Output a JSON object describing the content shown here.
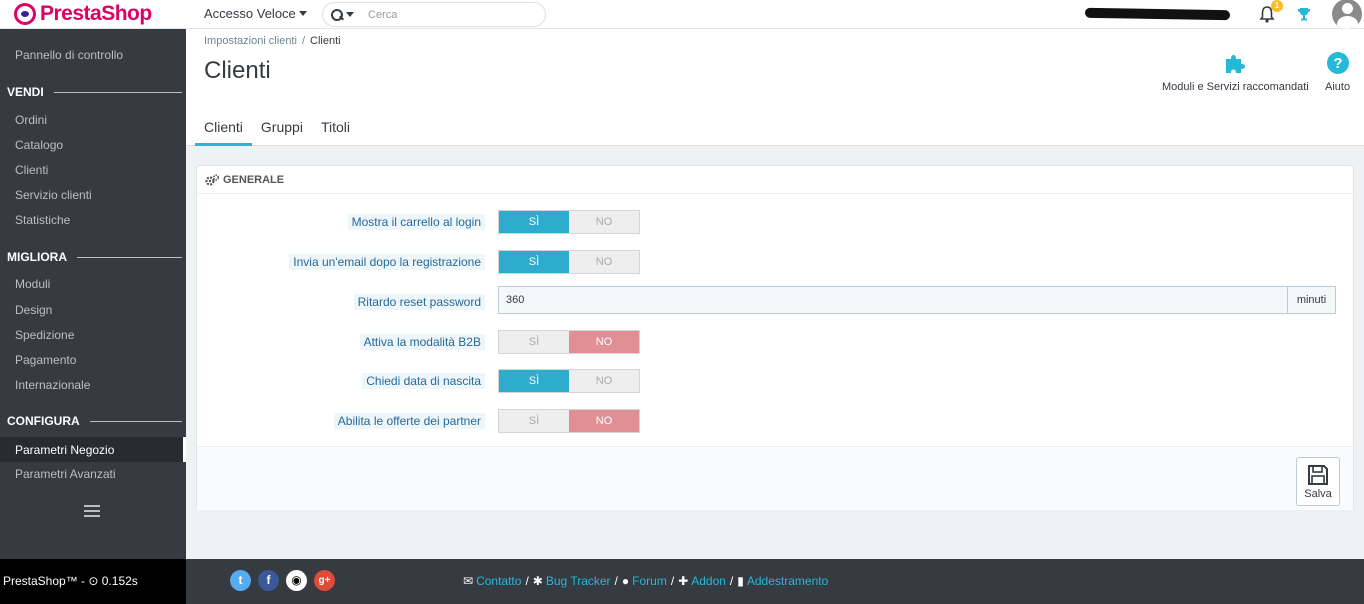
{
  "header": {
    "brand": "PrestaShop",
    "quick_access": "Accesso Veloce",
    "search_placeholder": "Cerca",
    "notifications_count": "1"
  },
  "sidebar": {
    "dashboard": "Pannello di controllo",
    "sections": [
      {
        "title": "VENDI",
        "items": [
          "Ordini",
          "Catalogo",
          "Clienti",
          "Servizio clienti",
          "Statistiche"
        ]
      },
      {
        "title": "MIGLIORA",
        "items": [
          "Moduli",
          "Design",
          "Spedizione",
          "Pagamento",
          "Internazionale"
        ]
      },
      {
        "title": "CONFIGURA",
        "items": [
          "Parametri Negozio",
          "Parametri Avanzati"
        ]
      }
    ],
    "active_item": "Parametri Negozio"
  },
  "page": {
    "breadcrumb": [
      "Impostazioni clienti",
      "Clienti"
    ],
    "title": "Clienti",
    "toolbar": {
      "modules_label": "Moduli e Servizi raccomandati",
      "help_label": "Aiuto"
    },
    "tabs": [
      "Clienti",
      "Gruppi",
      "Titoli"
    ],
    "active_tab": "Clienti"
  },
  "panel": {
    "title": "GENERALE",
    "yes_label": "SÌ",
    "no_label": "NO",
    "rows": [
      {
        "label": "Mostra il carrello al login",
        "type": "switch",
        "value": "yes"
      },
      {
        "label": "Invia un'email dopo la registrazione",
        "type": "switch",
        "value": "yes"
      },
      {
        "label": "Ritardo reset password",
        "type": "input",
        "value": "360",
        "suffix": "minuti"
      },
      {
        "label": "Attiva la modalità B2B",
        "type": "switch",
        "value": "no"
      },
      {
        "label": "Chiedi data di nascita",
        "type": "switch",
        "value": "yes"
      },
      {
        "label": "Abilita le offerte dei partner",
        "type": "switch",
        "value": "no"
      }
    ],
    "save_label": "Salva"
  },
  "footer": {
    "version": "PrestaShop™ - ⊙ 0.152s",
    "social": [
      "twitter",
      "facebook",
      "github",
      "google-plus"
    ],
    "links": [
      "Contatto",
      "Bug Tracker",
      "Forum",
      "Addon",
      "Addestramento"
    ]
  },
  "colors": {
    "accent": "#25b9d7",
    "switch_yes": "#2eacce",
    "switch_no": "#e08f95",
    "sidebar": "#363a41",
    "brand": "#df0067"
  }
}
